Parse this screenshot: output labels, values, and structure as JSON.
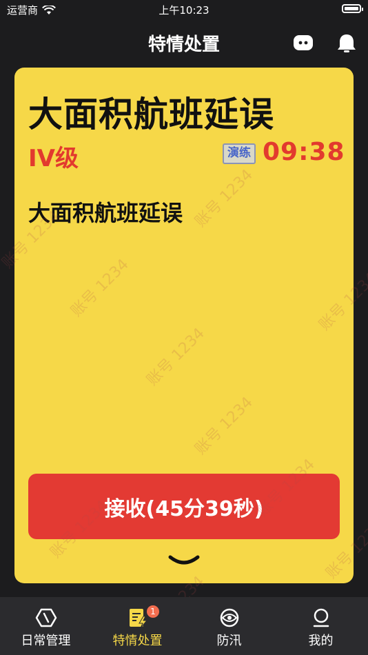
{
  "status_bar": {
    "carrier": "运营商",
    "time": "上午10:23"
  },
  "nav": {
    "title": "特情处置"
  },
  "card": {
    "title": "大面积航班延误",
    "level": "IV级",
    "drill_badge": "演练",
    "countdown": "09:38",
    "description": "大面积航班延误",
    "accept_button": "接收(45分39秒)"
  },
  "watermark": "账号 1234",
  "tabs": [
    {
      "label": "日常管理",
      "icon": "hexagon-icon"
    },
    {
      "label": "特情处置",
      "icon": "document-bolt-icon",
      "badge": "1"
    },
    {
      "label": "防汛",
      "icon": "eye-ring-icon"
    },
    {
      "label": "我的",
      "icon": "user-icon"
    }
  ],
  "colors": {
    "accent": "#f6d848",
    "alert": "#e33a33",
    "background": "#1c1c1e"
  }
}
